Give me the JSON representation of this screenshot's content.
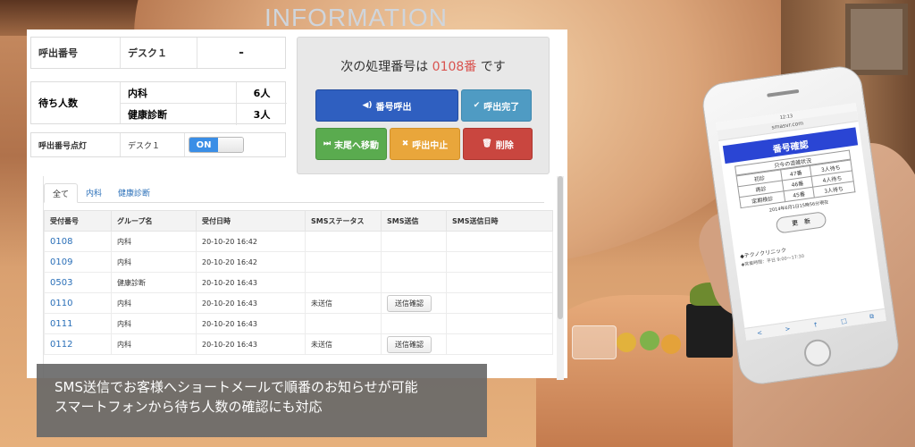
{
  "background": {
    "sign_text": "INFORMATION"
  },
  "call_box": {
    "label": "呼出番号",
    "desk": "デスク１",
    "value": "-"
  },
  "waiting": {
    "label": "待ち人数",
    "rows": [
      {
        "name": "内科",
        "count": "6人"
      },
      {
        "name": "健康診断",
        "count": "3人"
      }
    ]
  },
  "lamp_box": {
    "label": "呼出番号点灯",
    "desk": "デスク１",
    "toggle": {
      "on_label": "ON",
      "state": "on"
    }
  },
  "panel": {
    "title_prefix": "次の処理番号は",
    "title_number": "0108番",
    "title_suffix": "です",
    "buttons": {
      "call": {
        "icon": "speaker-icon",
        "glyph": "◀)",
        "label": "番号呼出"
      },
      "done": {
        "icon": "check-icon",
        "glyph": "✔",
        "label": "呼出完了"
      },
      "move_last": {
        "icon": "skip-forward-icon",
        "glyph": "⏭",
        "label": "末尾へ移動"
      },
      "stop": {
        "icon": "x-icon",
        "glyph": "✖",
        "label": "呼出中止"
      },
      "delete": {
        "icon": "trash-icon",
        "glyph": "🗑",
        "label": "削除"
      }
    },
    "colors": {
      "call": "#2f5fc0",
      "done": "#4f9bc3",
      "move_last": "#5aab4f",
      "stop": "#e9a63b",
      "delete": "#c9463f",
      "number": "#d9534f"
    }
  },
  "tabs": [
    {
      "label": "全て",
      "active": true
    },
    {
      "label": "内科",
      "active": false
    },
    {
      "label": "健康診断",
      "active": false
    }
  ],
  "table": {
    "headers": [
      "受付番号",
      "グループ名",
      "受付日時",
      "SMSステータス",
      "SMS送信",
      "SMS送信日時"
    ],
    "rows": [
      {
        "number": "0108",
        "group": "内科",
        "datetime": "20-10-20 16:42",
        "sms_status": "",
        "sms_button": "",
        "sms_sent": ""
      },
      {
        "number": "0109",
        "group": "内科",
        "datetime": "20-10-20 16:42",
        "sms_status": "",
        "sms_button": "",
        "sms_sent": ""
      },
      {
        "number": "0503",
        "group": "健康診断",
        "datetime": "20-10-20 16:43",
        "sms_status": "",
        "sms_button": "",
        "sms_sent": ""
      },
      {
        "number": "0110",
        "group": "内科",
        "datetime": "20-10-20 16:43",
        "sms_status": "未送信",
        "sms_button": "送信確認",
        "sms_sent": ""
      },
      {
        "number": "0111",
        "group": "内科",
        "datetime": "20-10-20 16:43",
        "sms_status": "",
        "sms_button": "",
        "sms_sent": ""
      },
      {
        "number": "0112",
        "group": "内科",
        "datetime": "20-10-20 16:43",
        "sms_status": "未送信",
        "sms_button": "送信確認",
        "sms_sent": ""
      }
    ]
  },
  "caption": {
    "line1": "SMS送信でお客様へショートメールで順番のお知らせが可能",
    "line2": "スマートフォンから待ち人数の確認にも対応"
  },
  "phone": {
    "status": "12:13",
    "url": "smasvr.com",
    "header": "番号確認",
    "table_title": "只今の混雑状況",
    "rows": [
      {
        "group": "初診",
        "number": "47番",
        "wait": "3人待ち"
      },
      {
        "group": "再診",
        "number": "46番",
        "wait": "4人待ち"
      },
      {
        "group": "定期検診",
        "number": "45番",
        "wait": "3人待ち"
      }
    ],
    "timestamp": "2014年6月1日15時56分現在",
    "update_button": "更　新",
    "clinic": "◆テクノクリニック",
    "hours": "◆営業時間：平日 9:00〜17:30",
    "bar_icons": [
      "<",
      ">",
      "↑",
      "□",
      "⧉"
    ]
  }
}
